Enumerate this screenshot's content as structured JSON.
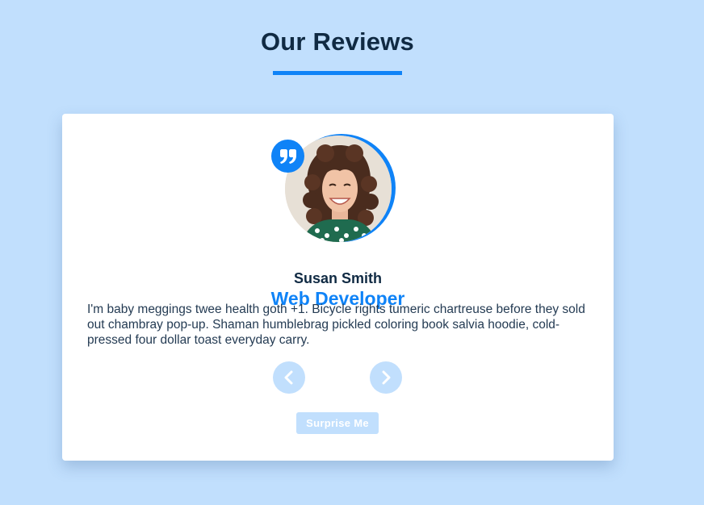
{
  "header": {
    "title": "Our Reviews"
  },
  "review": {
    "author": "Susan Smith",
    "job": "Web Developer",
    "text": "I'm baby meggings twee health goth +1. Bicycle rights tumeric chartreuse before they sold out chambray pop-up. Shaman humblebrag pickled coloring book salvia hoodie, cold-pressed four dollar toast everyday carry.",
    "image_icon": "person-photo",
    "quote_icon": "quote-right-icon"
  },
  "controls": {
    "prev_icon": "chevron-left-icon",
    "next_icon": "chevron-right-icon",
    "random_label": "Surprise Me"
  },
  "colors": {
    "background": "#c1dffd",
    "accent": "#0f83f7",
    "heading": "#102a43",
    "card": "#ffffff"
  }
}
